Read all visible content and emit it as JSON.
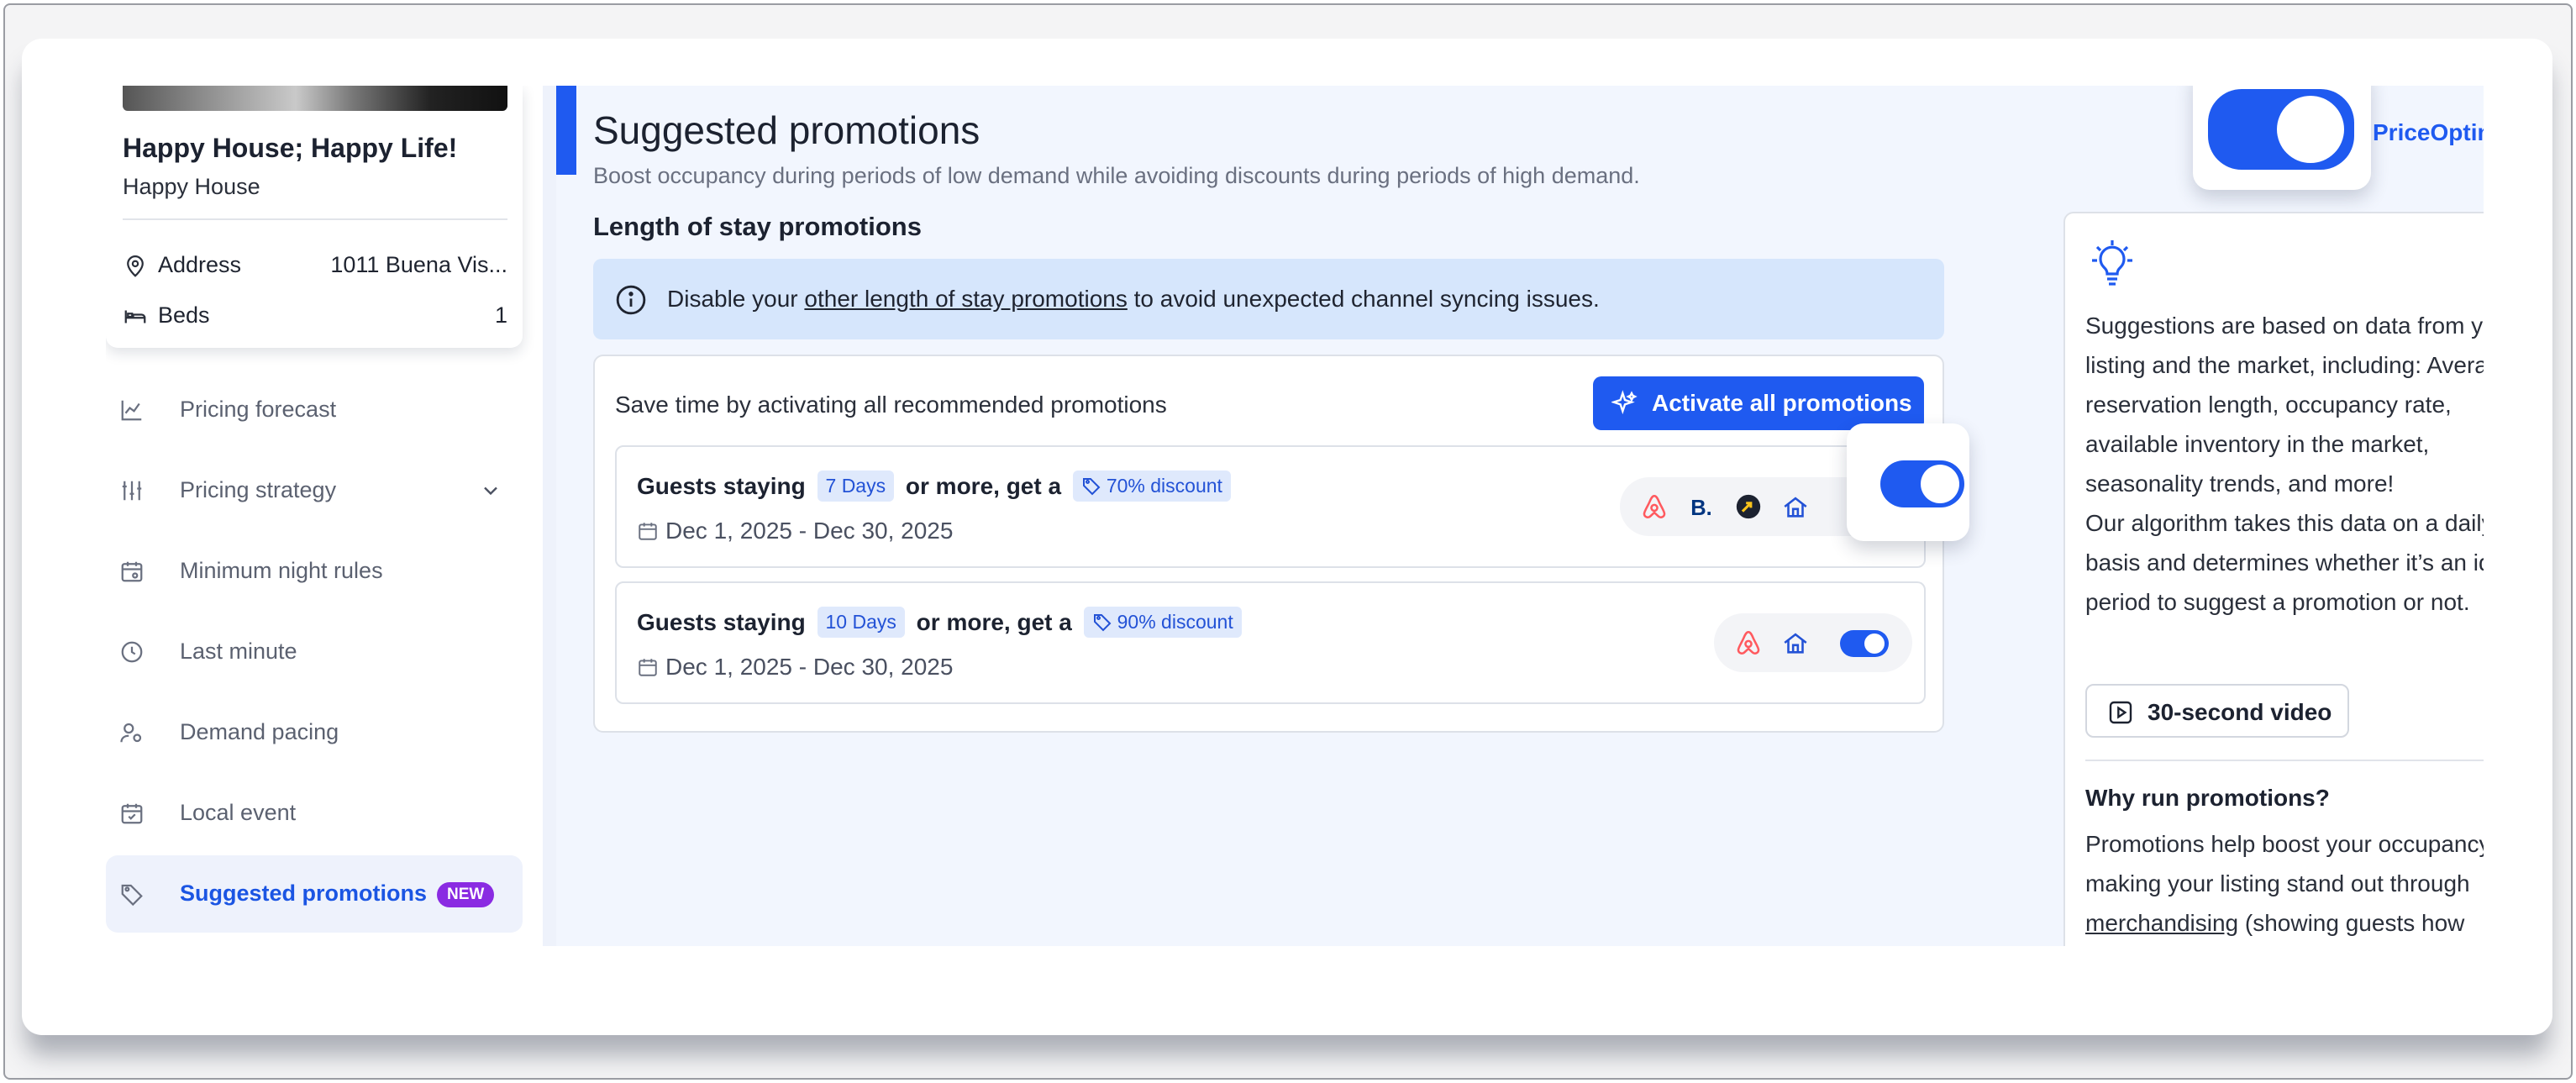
{
  "property": {
    "title": "Happy House; Happy Life!",
    "subtitle": "Happy House",
    "address_label": "Address",
    "address_value": "1011 Buena Vis...",
    "beds_label": "Beds",
    "beds_value": "1"
  },
  "sidebar": {
    "items": [
      {
        "label": "Pricing forecast",
        "icon": "chart-line-icon"
      },
      {
        "label": "Pricing strategy",
        "icon": "sliders-icon"
      },
      {
        "label": "Minimum night rules",
        "icon": "calendar-icon"
      },
      {
        "label": "Last minute",
        "icon": "clock-icon"
      },
      {
        "label": "Demand pacing",
        "icon": "user-gear-icon"
      },
      {
        "label": "Local event",
        "icon": "calendar-check-icon"
      },
      {
        "label": "Suggested promotions",
        "icon": "tag-icon",
        "badge": "NEW"
      }
    ]
  },
  "header": {
    "title": "Suggested promotions",
    "subtitle": "Boost occupancy during periods of low demand while avoiding discounts during periods of high demand.",
    "optimizer_label": "PriceOptimizer on"
  },
  "section": {
    "title": "Length of stay promotions"
  },
  "alert": {
    "prefix": "Disable your ",
    "link": "other length of stay promotions",
    "suffix": " to avoid unexpected channel syncing issues."
  },
  "promotions": {
    "lead": "Save time by activating all recommended promotions",
    "activate_label": "Activate all promotions",
    "rows": [
      {
        "prefix": "Guests staying",
        "days": "7 Days",
        "middle": "or more, get a",
        "discount": "70% discount",
        "dates": "Dec 1, 2025 - Dec 30, 2025",
        "channels": [
          "airbnb-icon",
          "booking-icon",
          "expedia-icon",
          "vrbo-icon"
        ]
      },
      {
        "prefix": "Guests staying",
        "days": "10 Days",
        "middle": "or more, get a",
        "discount": "90% discount",
        "dates": "Dec 1, 2025 - Dec 30, 2025",
        "channels": [
          "airbnb-icon",
          "vrbo-icon"
        ]
      }
    ]
  },
  "tips": {
    "body1": "Suggestions are based on data from your listing and the market, including: Average reservation length, occupancy rate, available inventory in the market, seasonality trends, and more!",
    "body2": "Our algorithm takes this data on a daily basis and determines whether it’s an ideal period to suggest a promotion or not.",
    "video_label": "30-second video",
    "why_title": "Why run promotions?",
    "why_prefix": "Promotions help boost your occupancy by making your listing stand out through ",
    "why_link": "merchandising",
    "why_suffix": " (showing guests how"
  },
  "colors": {
    "accent": "#1f5af0",
    "badge": "#8a2be2",
    "airbnb": "#ff5a5f",
    "booking": "#003580"
  }
}
